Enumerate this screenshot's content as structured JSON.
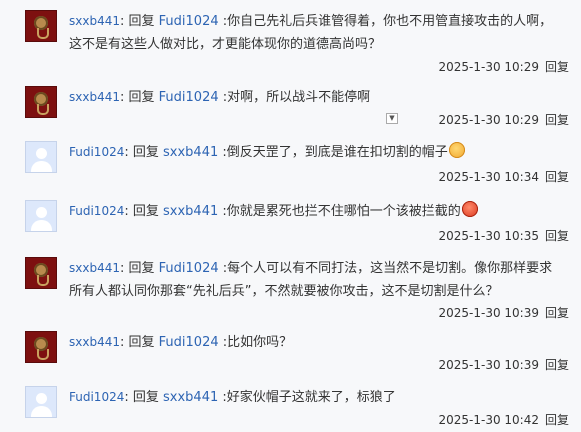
{
  "reply_word": "回复",
  "comments": [
    {
      "user": "sxxb441",
      "target": "Fudi1024",
      "text": ":你自己先礼后兵谁管得着，你也不用管直接攻击的人啊，这不是有这些人做对比，才更能体现你的道德高尚吗？",
      "time": "2025-1-30 10:29",
      "reply_label": "回复",
      "avatar": "red"
    },
    {
      "user": "sxxb441",
      "target": "Fudi1024",
      "text": ":对啊，所以战斗不能停啊",
      "time": "2025-1-30 10:29",
      "reply_label": "回复",
      "avatar": "red",
      "dropdown_icon": "chevron-down-icon"
    },
    {
      "user": "Fudi1024",
      "target": "sxxb441",
      "text": ":倒反天罡了，到底是谁在扣切割的帽子",
      "emoji": "surprised-face-icon",
      "time": "2025-1-30 10:34",
      "reply_label": "回复",
      "avatar": "default"
    },
    {
      "user": "Fudi1024",
      "target": "sxxb441",
      "text": ":你就是累死也拦不住哪怕一个该被拦截的",
      "emoji": "angry-face-icon",
      "time": "2025-1-30 10:35",
      "reply_label": "回复",
      "avatar": "default"
    },
    {
      "user": "sxxb441",
      "target": "Fudi1024",
      "text": ":每个人可以有不同打法，这当然不是切割。像你那样要求所有人都认同你那套“先礼后兵”，不然就要被你攻击，这不是切割是什么？",
      "time": "2025-1-30 10:39",
      "reply_label": "回复",
      "avatar": "red"
    },
    {
      "user": "sxxb441",
      "target": "Fudi1024",
      "text": ":比如你吗？",
      "time": "2025-1-30 10:39",
      "reply_label": "回复",
      "avatar": "red"
    },
    {
      "user": "Fudi1024",
      "target": "sxxb441",
      "text": ":好家伙帽子这就来了，标狼了",
      "time": "2025-1-30 10:42",
      "reply_label": "回复",
      "avatar": "default"
    }
  ]
}
